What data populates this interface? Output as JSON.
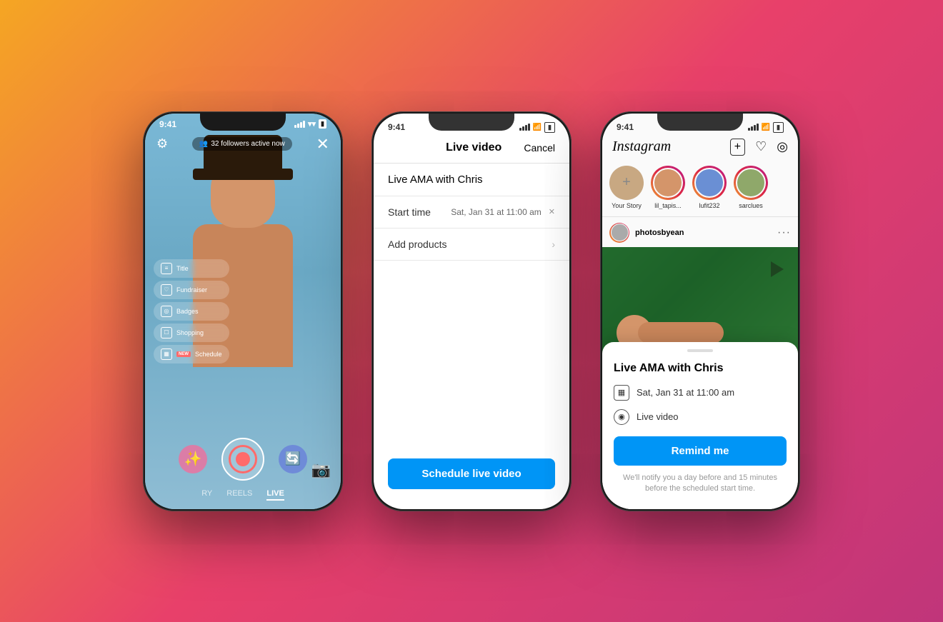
{
  "background": {
    "gradient_start": "#f5a623",
    "gradient_end": "#c0357a"
  },
  "phone1": {
    "status_time": "9:41",
    "followers_text": "32 followers active now",
    "menu_items": [
      {
        "id": "title",
        "label": "Title",
        "icon": "≡"
      },
      {
        "id": "fundraiser",
        "label": "Fundraiser",
        "icon": "♡"
      },
      {
        "id": "badges",
        "label": "Badges",
        "icon": "◎"
      },
      {
        "id": "shopping",
        "label": "Shopping",
        "icon": "☐"
      },
      {
        "id": "schedule",
        "label": "Schedule",
        "icon": "▦",
        "new": true
      }
    ],
    "nav_tabs": [
      "RY",
      "REELS",
      "LIVE"
    ],
    "active_tab": "LIVE"
  },
  "phone2": {
    "status_time": "9:41",
    "header_title": "Live video",
    "header_cancel": "Cancel",
    "live_title_placeholder": "Live AMA with Chris",
    "start_time_label": "Start time",
    "start_time_value": "Sat, Jan 31 at 11:00 am",
    "add_products_label": "Add products",
    "schedule_btn": "Schedule live video"
  },
  "phone3": {
    "status_time": "9:41",
    "logo": "Instagram",
    "stories": [
      {
        "id": "your-story",
        "label": "Your Story"
      },
      {
        "id": "lil_tapisa",
        "label": "lil_tapisa..."
      },
      {
        "id": "lufit232",
        "label": "lufit232"
      },
      {
        "id": "sarclues",
        "label": "sarclues"
      }
    ],
    "post_username": "photosbyean",
    "sheet": {
      "title": "Live AMA with Chris",
      "date_icon": "▦",
      "date_text": "Sat, Jan 31 at 11:00 am",
      "video_icon": "◉",
      "video_text": "Live video",
      "remind_btn": "Remind me",
      "disclaimer": "We'll notify you a day before and 15 minutes before the\nscheduled start time."
    }
  }
}
